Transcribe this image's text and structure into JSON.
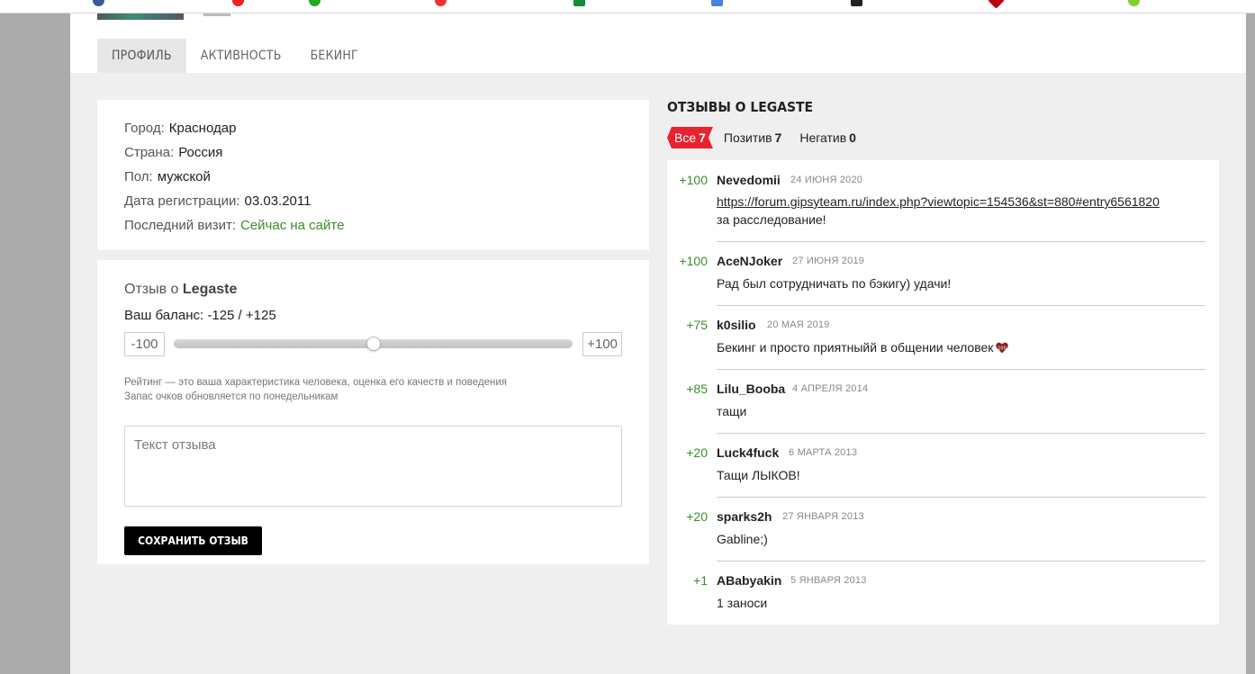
{
  "tabs": [
    "ПРОФИЛЬ",
    "АКТИВНОСТЬ",
    "БЕКИНГ"
  ],
  "profile": {
    "city_label": "Город:",
    "city": "Краснодар",
    "country_label": "Страна:",
    "country": "Россия",
    "gender_label": "Пол:",
    "gender": "мужской",
    "reg_label": "Дата регистрации:",
    "reg_date": "03.03.2011",
    "visit_label": "Последний визит:",
    "visit": "Сейчас на сайте"
  },
  "review_form": {
    "title_prefix": "Отзыв о",
    "title_name": "Legaste",
    "balance": "Ваш баланс: -125 / +125",
    "min": "-100",
    "max": "+100",
    "slider_value": 0,
    "hint_1": "Рейтинг — это ваша характеристика человека, оценка его качеств и поведения",
    "hint_2": "Запас очков обновляется по понедельникам",
    "placeholder": "Текст отзыва",
    "save_label": "СОХРАНИТЬ ОТЗЫВ"
  },
  "reviews_panel": {
    "title": "ОТЗЫВЫ О LEGASTE",
    "filters": [
      {
        "label": "Все",
        "count": "7"
      },
      {
        "label": "Позитив",
        "count": "7"
      },
      {
        "label": "Негатив",
        "count": "0"
      }
    ],
    "items": [
      {
        "score": "+100",
        "author": "Nevedomii",
        "date": "24 ИЮНЯ 2020",
        "link": "https://forum.gipsyteam.ru/index.php?viewtopic=154536&st=880#entry6561820",
        "text": "за расследование!"
      },
      {
        "score": "+100",
        "author": "AceNJoker",
        "date": "27 ИЮНЯ 2019",
        "text": "Рад был сотрудничать по бэкигу) удачи!"
      },
      {
        "score": "+75",
        "author": "k0silio",
        "date": "20 МАЯ 2019",
        "text": "Бекинг и просто приятныйй в общении человек"
      },
      {
        "score": "+85",
        "author": "Lilu_Booba",
        "date": "4 АПРЕЛЯ 2014",
        "text": "тащи"
      },
      {
        "score": "+20",
        "author": "Luck4fuck",
        "date": "6 МАРТА 2013",
        "text": "Тащи ЛЫКОВ!"
      },
      {
        "score": "+20",
        "author": "sparks2h",
        "date": "27 ЯНВАРЯ 2013",
        "text": "Gabline;)"
      },
      {
        "score": "+1",
        "author": "ABabyakin",
        "date": "5 ЯНВАРЯ 2013",
        "text": "1 заноси"
      }
    ]
  },
  "colors": {
    "accent_red": "#e8232f",
    "positive_green": "#3b8d28",
    "online_green": "#3b8d28"
  }
}
